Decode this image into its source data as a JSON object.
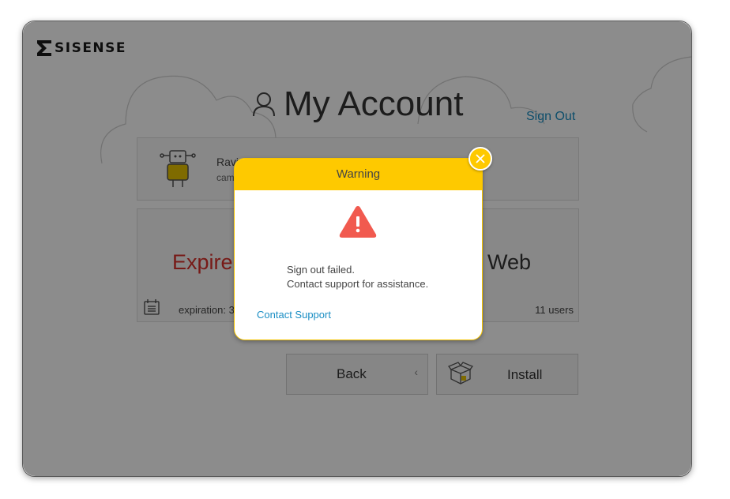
{
  "brand": {
    "logo_text": "SISENSE"
  },
  "header": {
    "title": "My Account",
    "sign_out_label": "Sign Out"
  },
  "profile": {
    "name": "Ravi",
    "subtitle": "cam"
  },
  "license": {
    "status": "Expire",
    "edition": "Web",
    "expiration_label": "expiration: 3",
    "users": "11 users"
  },
  "actions": {
    "back_label": "Back",
    "back_chevron": "‹",
    "install_label": "Install"
  },
  "dialog": {
    "title": "Warning",
    "message_line1": "Sign out failed.",
    "message_line2": "Contact support for assistance.",
    "contact_link": "Contact Support",
    "close_symbol": "×"
  },
  "icons": [
    "sisense-logo-icon",
    "user-icon",
    "robot-avatar-icon",
    "calendar-icon",
    "box-icon",
    "warning-icon",
    "close-icon"
  ],
  "colors": {
    "accent": "#fec900",
    "link": "#1a8ec4",
    "error": "#d9312b",
    "warning_red": "#f15a4f"
  }
}
